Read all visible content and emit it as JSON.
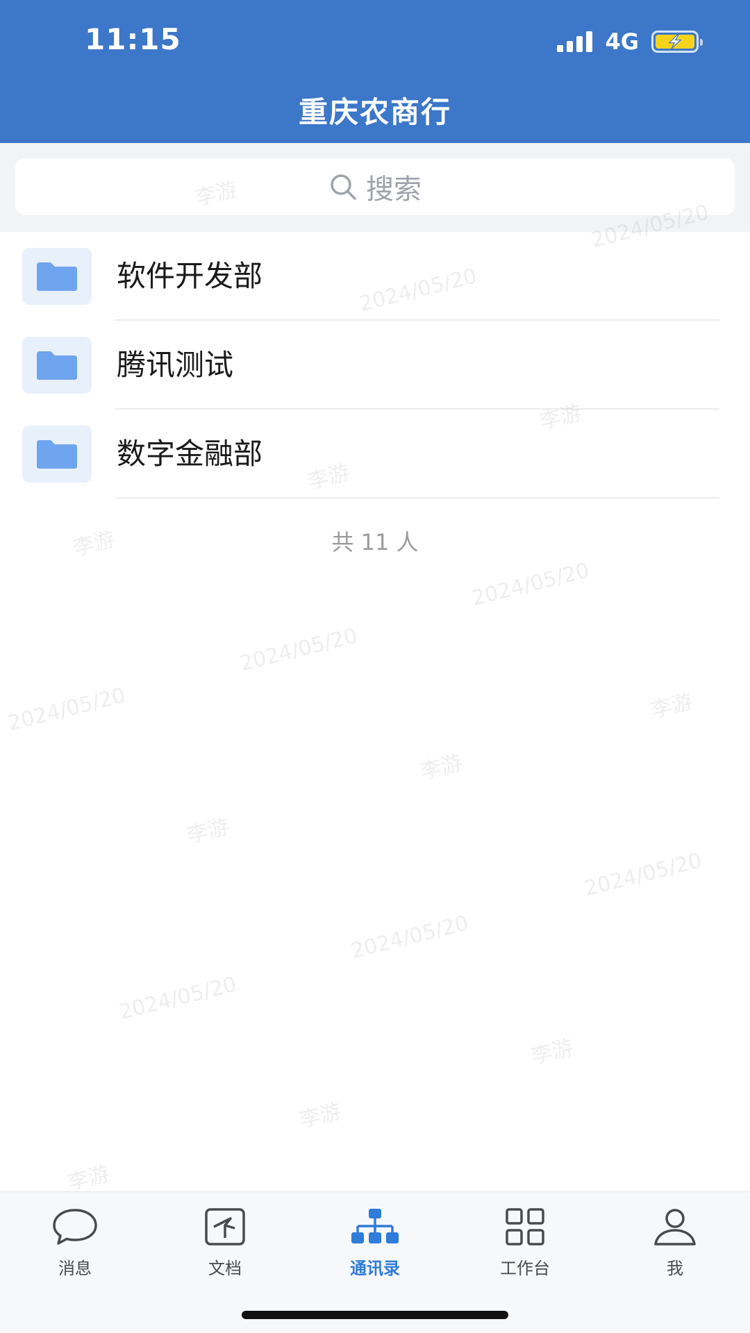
{
  "status_bar": {
    "time": "11:15",
    "network": "4G",
    "battery_icon": "battery-charging-icon",
    "signal_icon": "signal-icon"
  },
  "header": {
    "title": "重庆农商行"
  },
  "search": {
    "placeholder": "搜索",
    "icon": "search-icon"
  },
  "departments": [
    {
      "label": "软件开发部",
      "icon": "folder-icon"
    },
    {
      "label": "腾讯测试",
      "icon": "folder-icon"
    },
    {
      "label": "数字金融部",
      "icon": "folder-icon"
    }
  ],
  "member_count": "共 11 人",
  "watermark": {
    "name": "李游",
    "date": "2024/05/20"
  },
  "tabbar": {
    "items": [
      {
        "label": "消息",
        "icon": "chat-bubble-icon"
      },
      {
        "label": "文档",
        "icon": "document-icon"
      },
      {
        "label": "通讯录",
        "icon": "org-chart-icon",
        "active": true
      },
      {
        "label": "工作台",
        "icon": "grid-icon"
      },
      {
        "label": "我",
        "icon": "person-icon"
      }
    ]
  },
  "colors": {
    "header_bg": "#3c77c9",
    "active_tab": "#2f7cd9",
    "folder_icon": "#6fa4ef",
    "battery_fill": "#f5d31c"
  }
}
